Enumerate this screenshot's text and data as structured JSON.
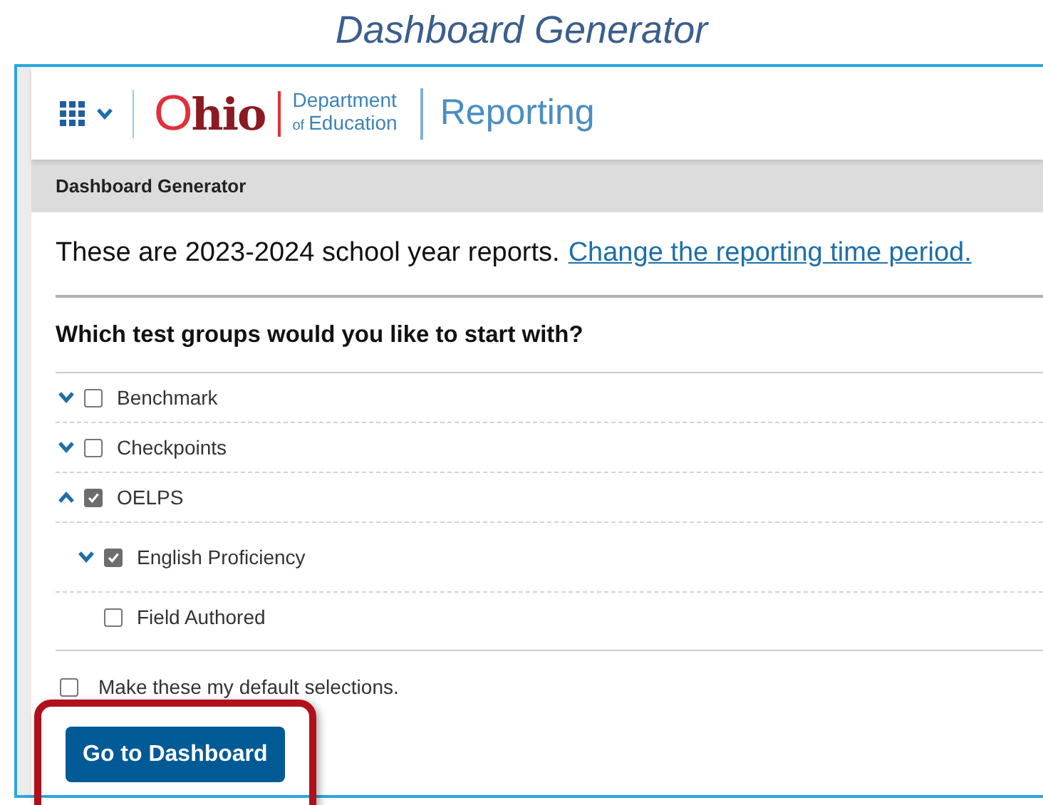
{
  "caption": "Dashboard Generator",
  "header": {
    "logo": {
      "state": "Ohio",
      "line1": "Department",
      "line2_small": "of",
      "line2": "Education"
    },
    "app_title": "Reporting"
  },
  "breadcrumb": "Dashboard Generator",
  "notice": {
    "text": "These are 2023-2024 school year reports.",
    "link": "Change the reporting time period."
  },
  "question": "Which test groups would you like to start with?",
  "test_groups": [
    {
      "kind": "group",
      "label": "Benchmark",
      "expanded": false,
      "checked": false
    },
    {
      "kind": "group",
      "label": "Checkpoints",
      "expanded": false,
      "checked": false
    },
    {
      "kind": "group",
      "label": "OELPS",
      "expanded": true,
      "checked": true,
      "children": [
        {
          "kind": "group",
          "label": "English Proficiency",
          "expanded": false,
          "checked": true
        },
        {
          "kind": "leaf",
          "label": "Field Authored",
          "checked": false
        }
      ]
    }
  ],
  "default_option": {
    "label": "Make these my default selections.",
    "checked": false
  },
  "primary_button": "Go to Dashboard"
}
